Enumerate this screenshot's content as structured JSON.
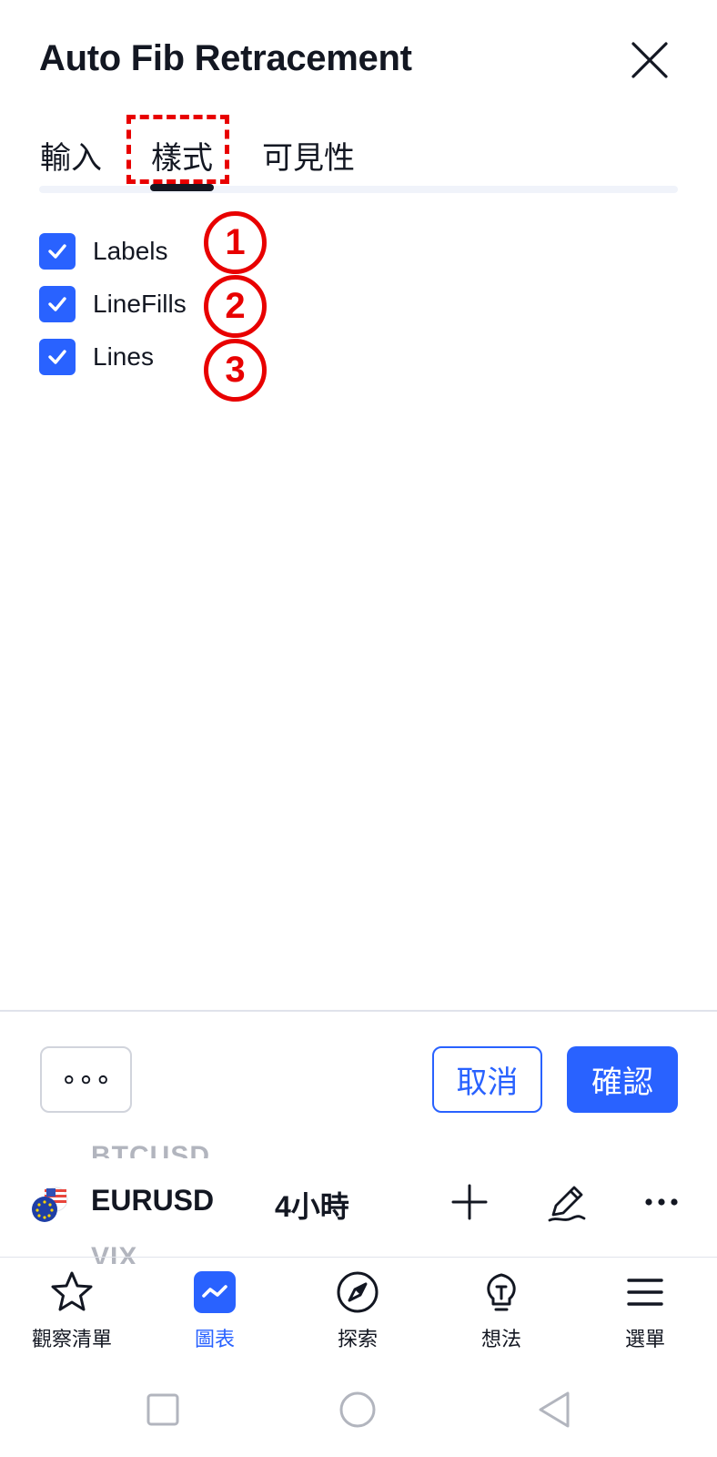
{
  "dialog": {
    "title": "Auto Fib Retracement",
    "tabs": [
      {
        "label": "輸入",
        "active": false
      },
      {
        "label": "樣式",
        "active": true
      },
      {
        "label": "可見性",
        "active": false
      }
    ],
    "options": [
      {
        "label": "Labels",
        "checked": true
      },
      {
        "label": "LineFills",
        "checked": true
      },
      {
        "label": "Lines",
        "checked": true
      }
    ],
    "annotations": [
      "1",
      "2",
      "3"
    ],
    "footer": {
      "more_label": "∘∘∘",
      "cancel_label": "取消",
      "ok_label": "確認"
    }
  },
  "chart_toolbar": {
    "symbol_prev": "BTCUSD",
    "symbol": "EURUSD",
    "symbol_next": "VIX",
    "interval": "4小時",
    "icons": [
      "plus-icon",
      "pen-icon",
      "more-dots-icon"
    ]
  },
  "bottom_nav": {
    "items": [
      {
        "label": "觀察清單",
        "icon": "star-icon",
        "active": false
      },
      {
        "label": "圖表",
        "icon": "chart-icon",
        "active": true
      },
      {
        "label": "探索",
        "icon": "compass-icon",
        "active": false
      },
      {
        "label": "想法",
        "icon": "lightbulb-icon",
        "active": false
      },
      {
        "label": "選單",
        "icon": "menu-icon",
        "active": false
      }
    ]
  },
  "colors": {
    "accent": "#2962ff",
    "annotation": "#e80000",
    "text": "#131722"
  }
}
